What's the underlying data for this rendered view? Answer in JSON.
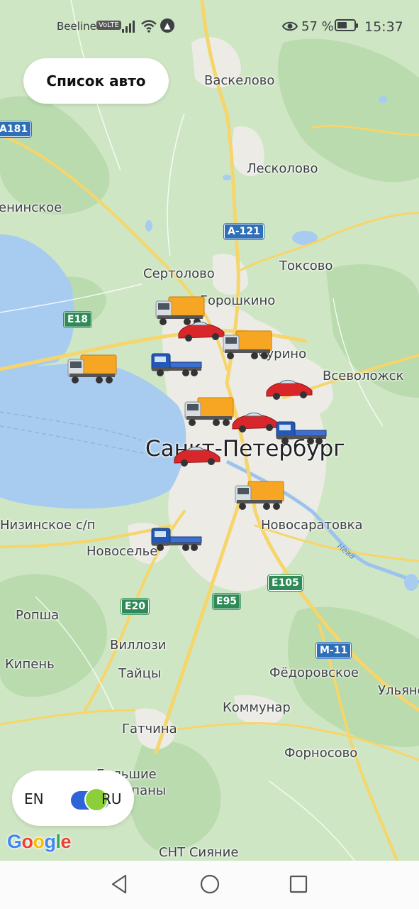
{
  "status_bar": {
    "carrier": "Beeline",
    "volte": "VoLTE",
    "battery_percent": "57 %",
    "battery_level": 0.57,
    "time": "15:37"
  },
  "header": {
    "list_button": "Список авто"
  },
  "map": {
    "places": {
      "vaskelovo": "Васкелово",
      "leskolovo": "Лесколово",
      "leninskoe": "енинское",
      "sertolovo": "Сертолово",
      "toksovo": "Токсово",
      "gorushkino": "Горошкино",
      "murino": "Мурино",
      "vsevolozhsk": "Всеволожск",
      "spb": "Санкт-Петербург",
      "novosaratovka": "Новосаратовка",
      "nizinskoe": "Низинское с/п",
      "novoselye": "Новоселье",
      "ropsha": "Ропша",
      "villozi": "Виллози",
      "kipen": "Кипень",
      "taitsy": "Тайцы",
      "fedorovskoe": "Фёдоровское",
      "ulyanovka": "Ульянов",
      "kommunar": "Коммунар",
      "gatchina": "Гатчина",
      "fornosovo": "Форносово",
      "bolshie": "Большие",
      "kolpany": "Колпаны",
      "snt": "СНТ Сияние"
    },
    "roads": {
      "a181": "А181",
      "a121": "А-121",
      "e18": "E18",
      "e20": "E20",
      "e95": "E95",
      "e105": "E105",
      "m11": "М-11"
    },
    "river": "Нева",
    "vehicles": [
      {
        "type": "truck"
      },
      {
        "type": "car"
      },
      {
        "type": "truck"
      },
      {
        "type": "truck"
      },
      {
        "type": "flatbed"
      },
      {
        "type": "car"
      },
      {
        "type": "truck"
      },
      {
        "type": "car"
      },
      {
        "type": "flatbed"
      },
      {
        "type": "car"
      },
      {
        "type": "truck"
      },
      {
        "type": "flatbed"
      }
    ]
  },
  "language_toggle": {
    "left_label": "EN",
    "right_label": "RU",
    "selected": "RU"
  },
  "attribution": "Google",
  "colors": {
    "accent": "#2f63d8",
    "toggle_knob": "#8dcf3a",
    "map_land": "#cfe6c4",
    "water": "#a8cbf0",
    "road": "#f6d56a"
  },
  "nav_bar": {
    "back": "back-icon",
    "home": "home-icon",
    "recents": "recents-icon"
  }
}
